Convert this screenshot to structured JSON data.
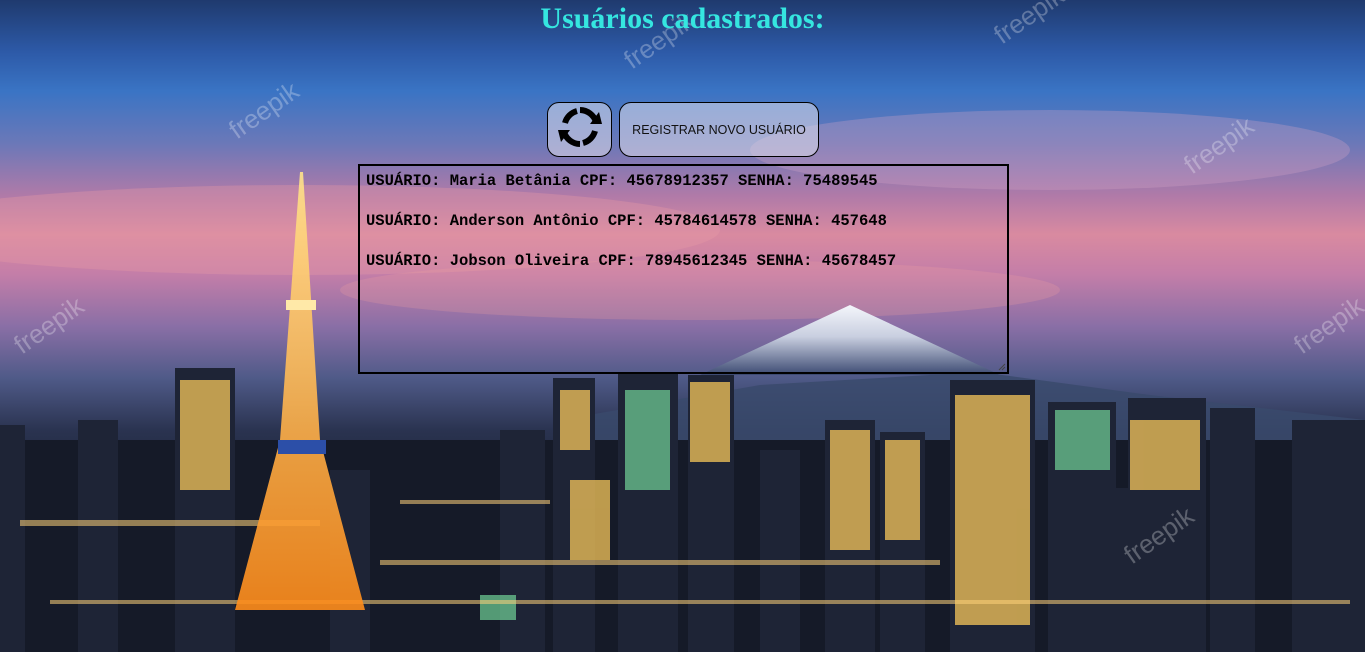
{
  "page": {
    "title": "Usuários cadastrados:"
  },
  "toolbar": {
    "refresh_icon": "refresh-icon",
    "register_label": "REGISTRAR NOVO USUÁRIO"
  },
  "users": [
    {
      "line": "USUÁRIO: Maria Betânia CPF: 45678912357 SENHA: 75489545"
    },
    {
      "line": "USUÁRIO: Anderson Antônio CPF: 45784614578 SENHA: 457648"
    },
    {
      "line": "USUÁRIO: Jobson Oliveira CPF: 78945612345 SENHA: 45678457"
    }
  ],
  "background": {
    "watermark_text": "freepik"
  },
  "colors": {
    "title": "#35e6e0",
    "text": "#000000"
  }
}
